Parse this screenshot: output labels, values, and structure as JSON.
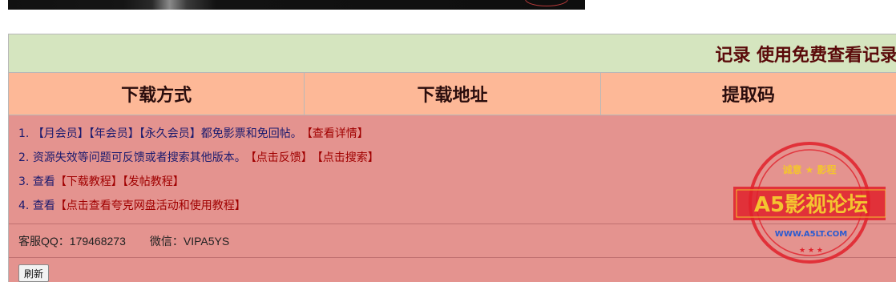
{
  "title": "记录 使用免费查看记录",
  "headers": [
    "下载方式",
    "下载地址",
    "提取码"
  ],
  "lines": [
    {
      "num": "1.",
      "text": "【月会员】【年会员】【永久会员】都免影票和免回帖。",
      "links": [
        "【查看详情】"
      ]
    },
    {
      "num": "2.",
      "text": "资源失效等问题可反馈或者搜索其他版本。",
      "links": [
        "【点击反馈】",
        "【点击搜索】"
      ]
    },
    {
      "num": "3.",
      "text": "查看",
      "links": [
        "【下载教程】",
        "【发帖教程】"
      ]
    },
    {
      "num": "4.",
      "text": "查看",
      "links": [
        "【点击查看夸克网盘活动和使用教程】"
      ]
    }
  ],
  "contact": {
    "qq": "客服QQ：179468273",
    "wechat": "微信：VIPA5YS"
  },
  "refresh_label": "刷新",
  "stamp": {
    "top_text": "诚意 ★ 影程",
    "main_text": "A5影视论坛",
    "url": "WWW.A5LT.COM",
    "color": "#e0202a",
    "fill_color": "#f4c430"
  }
}
